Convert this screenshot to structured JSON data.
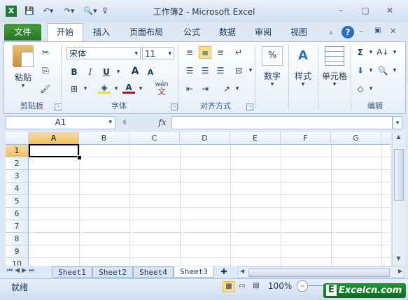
{
  "window": {
    "title": "工作簿2 - Microsoft Excel",
    "min_label": "–",
    "restore_label": "▢",
    "close_label": "✕"
  },
  "tabs": [
    "文件",
    "开始",
    "插入",
    "页面布局",
    "公式",
    "数据",
    "审阅",
    "视图"
  ],
  "clipboard": {
    "paste_label": "粘贴",
    "group_label": "剪贴板"
  },
  "font": {
    "name": "宋体",
    "size": "11",
    "group_label": "字体",
    "bold": "B",
    "italic": "I",
    "underline": "U",
    "grow": "A",
    "shrink": "A",
    "font_color": "A",
    "phonetic": "wén"
  },
  "alignment": {
    "group_label": "对齐方式"
  },
  "number": {
    "label": "数字",
    "percent": "%"
  },
  "styles": {
    "label": "样式"
  },
  "cells": {
    "label": "单元格"
  },
  "editing": {
    "group_label": "编辑",
    "sigma": "Σ"
  },
  "formula_bar": {
    "cell_ref": "A1",
    "fx": "fx",
    "content": ""
  },
  "columns": [
    "A",
    "B",
    "C",
    "D",
    "E",
    "F",
    "G"
  ],
  "rows": [
    "1",
    "2",
    "3",
    "4",
    "5",
    "6",
    "7",
    "8",
    "9",
    "10"
  ],
  "sheets": [
    "Sheet1",
    "Sheet2",
    "Sheet4",
    "Sheet3"
  ],
  "active_sheet": "Sheet3",
  "status": {
    "ready": "就绪",
    "zoom": "100%",
    "watermark": "Excelcn.com"
  }
}
